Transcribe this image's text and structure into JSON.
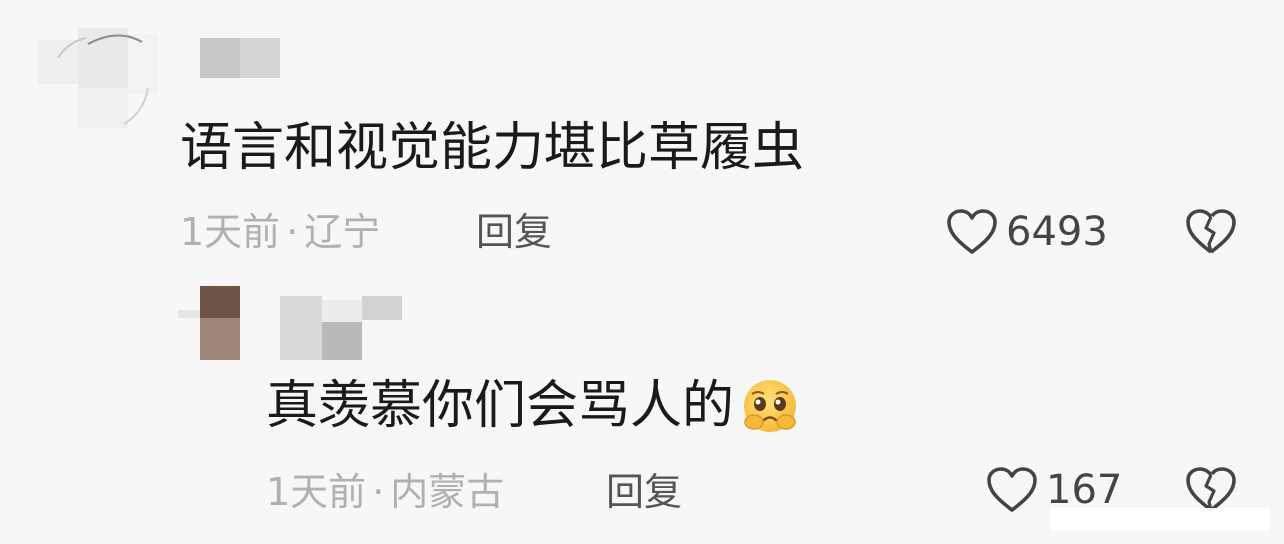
{
  "comments": [
    {
      "text": "语言和视觉能力堪比草履虫",
      "time": "1天前",
      "separator": "·",
      "location": "辽宁",
      "reply_label": "回复",
      "like_count": "6493",
      "like_icon": "heart-outline-icon",
      "dislike_icon": "broken-heart-icon"
    },
    {
      "text": "真羡慕你们会骂人的",
      "emoji": "pleading-face-emoji",
      "time": "1天前",
      "separator": "·",
      "location": "内蒙古",
      "reply_label": "回复",
      "like_count": "167",
      "like_icon": "heart-outline-icon",
      "dislike_icon": "broken-heart-icon"
    }
  ],
  "colors": {
    "background": "#f7f7f7",
    "text": "#1a1a1a",
    "meta": "#b0b0b0",
    "reply": "#555555",
    "icon": "#444444"
  }
}
